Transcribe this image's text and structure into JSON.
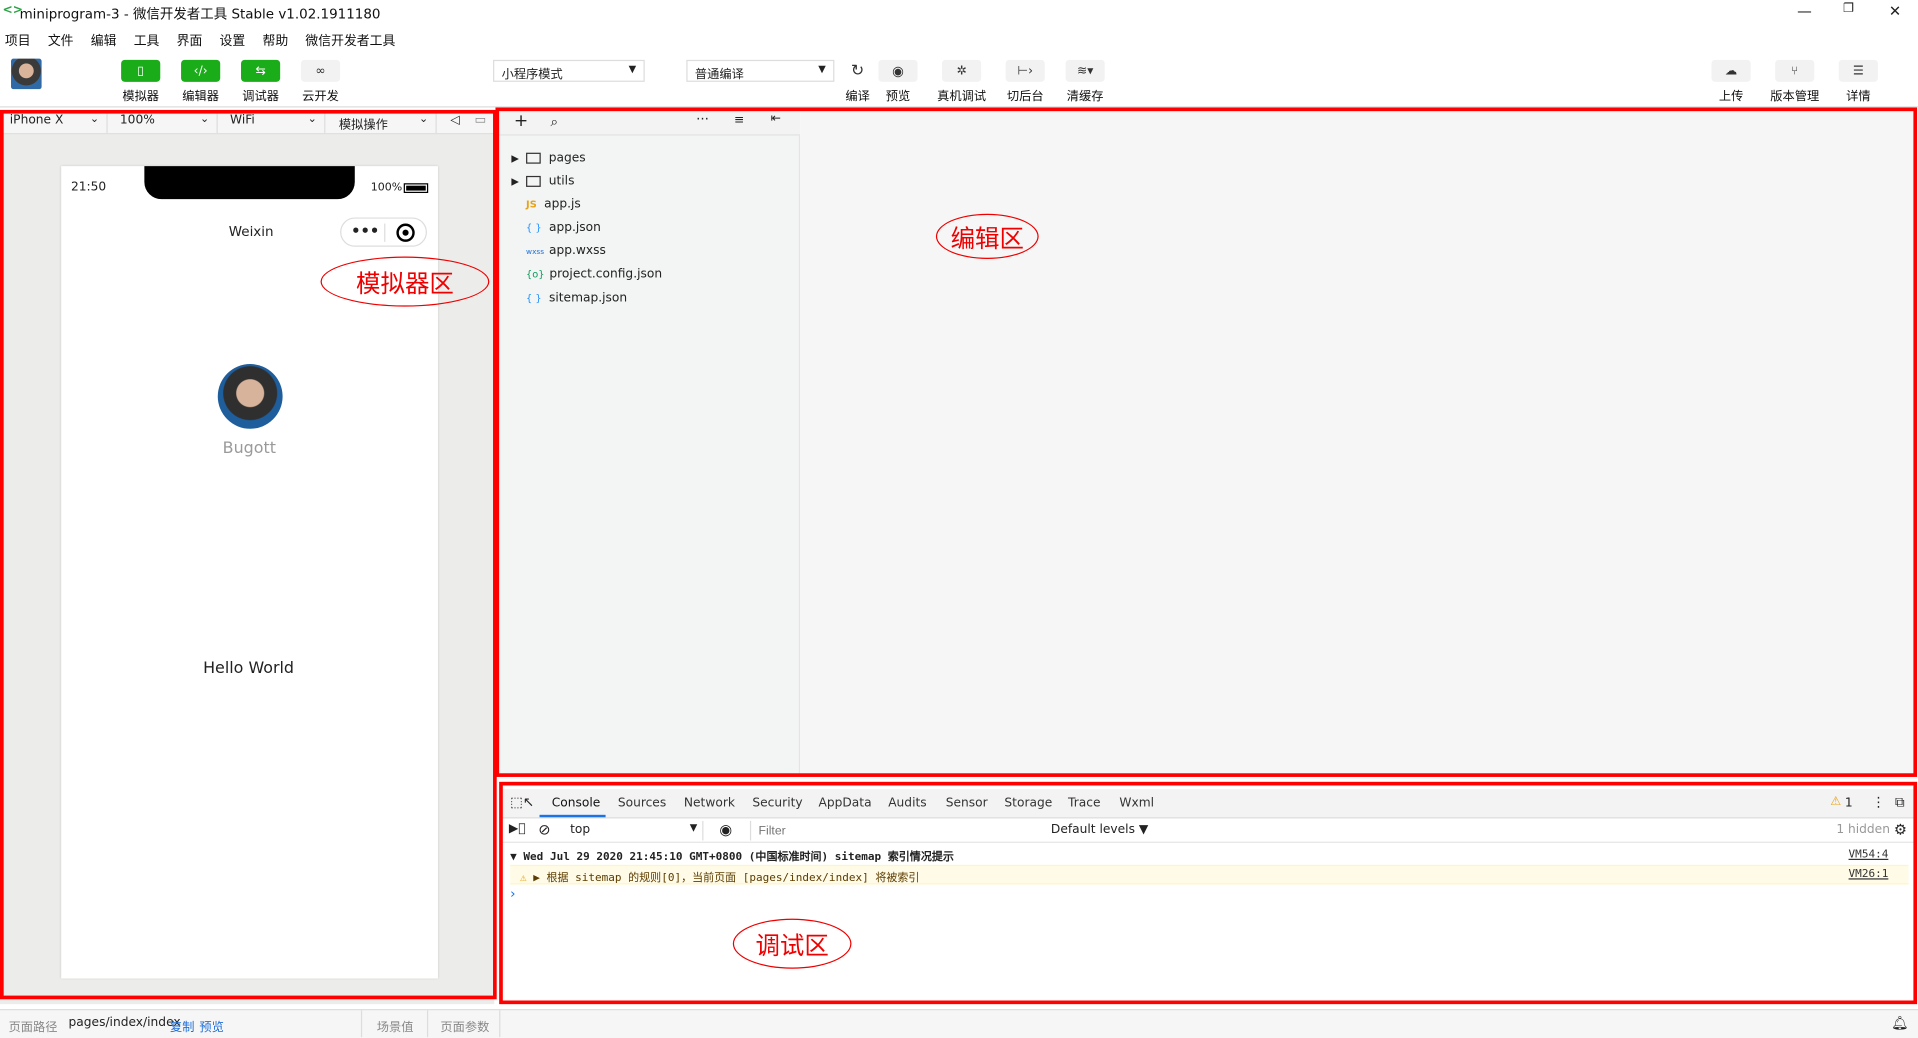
{
  "window": {
    "title": "miniprogram-3 - 微信开发者工具 Stable v1.02.1911180",
    "logo": "<>",
    "controls": [
      "—",
      "❐",
      "✕"
    ]
  },
  "menu": [
    "项目",
    "文件",
    "编辑",
    "工具",
    "界面",
    "设置",
    "帮助",
    "微信开发者工具"
  ],
  "toolbar": {
    "left": [
      {
        "label": "模拟器",
        "icon": "phone-icon"
      },
      {
        "label": "编辑器",
        "icon": "code-icon"
      },
      {
        "label": "调试器",
        "icon": "debug-icon"
      },
      {
        "label": "云开发",
        "icon": "cloud-link-icon"
      }
    ],
    "mode": "小程序模式",
    "compile_mode": "普通编译",
    "center": [
      {
        "label": "编译",
        "icon": "refresh-icon"
      },
      {
        "label": "预览",
        "icon": "eye-icon"
      },
      {
        "label": "真机调试",
        "icon": "bug-icon"
      },
      {
        "label": "切后台",
        "icon": "switch-icon"
      },
      {
        "label": "清缓存",
        "icon": "layers-icon"
      }
    ],
    "right": [
      {
        "label": "上传",
        "icon": "upload-icon"
      },
      {
        "label": "版本管理",
        "icon": "branch-icon"
      },
      {
        "label": "详情",
        "icon": "menu-icon"
      }
    ]
  },
  "device_bar": {
    "device": "iPhone X",
    "zoom": "100%",
    "network": "WiFi",
    "operation": "模拟操作"
  },
  "simulator": {
    "time": "21:50",
    "battery": "100%",
    "nav_title": "Weixin",
    "username": "Bugott",
    "content": "Hello World"
  },
  "file_tree": [
    {
      "name": "pages",
      "type": "folder"
    },
    {
      "name": "utils",
      "type": "folder"
    },
    {
      "name": "app.js",
      "type": "js",
      "badge": "JS"
    },
    {
      "name": "app.json",
      "type": "json",
      "badge": "{ }"
    },
    {
      "name": "app.wxss",
      "type": "wxss",
      "badge": "wxss"
    },
    {
      "name": "project.config.json",
      "type": "config",
      "badge": "{o}"
    },
    {
      "name": "sitemap.json",
      "type": "json",
      "badge": "{ }"
    }
  ],
  "annotations": {
    "simulator": "模拟器区",
    "editor": "编辑区",
    "debugger": "调试区"
  },
  "debugger": {
    "tabs": [
      "Console",
      "Sources",
      "Network",
      "Security",
      "AppData",
      "Audits",
      "Sensor",
      "Storage",
      "Trace",
      "Wxml"
    ],
    "active_tab": "Console",
    "warning_count": "1",
    "context": "top",
    "filter_placeholder": "Filter",
    "levels": "Default levels ▼",
    "hidden": "1 hidden",
    "log_header": "Wed Jul 29 2020 21:45:10 GMT+0800 (中国标准时间) sitemap 索引情况提示",
    "log_header_src": "VM54:4",
    "log_warning": "根据 sitemap 的规则[0]，当前页面 [pages/index/index] 将被索引",
    "log_warning_src": "VM26:1",
    "prompt": "›"
  },
  "status_bar": {
    "path_label": "页面路径",
    "path": "pages/index/index",
    "copy": "复制",
    "preview": "预览",
    "scene": "场景值",
    "params": "页面参数"
  },
  "colors": {
    "accent_green": "#1aad19",
    "annotation_red": "#ff0000"
  }
}
